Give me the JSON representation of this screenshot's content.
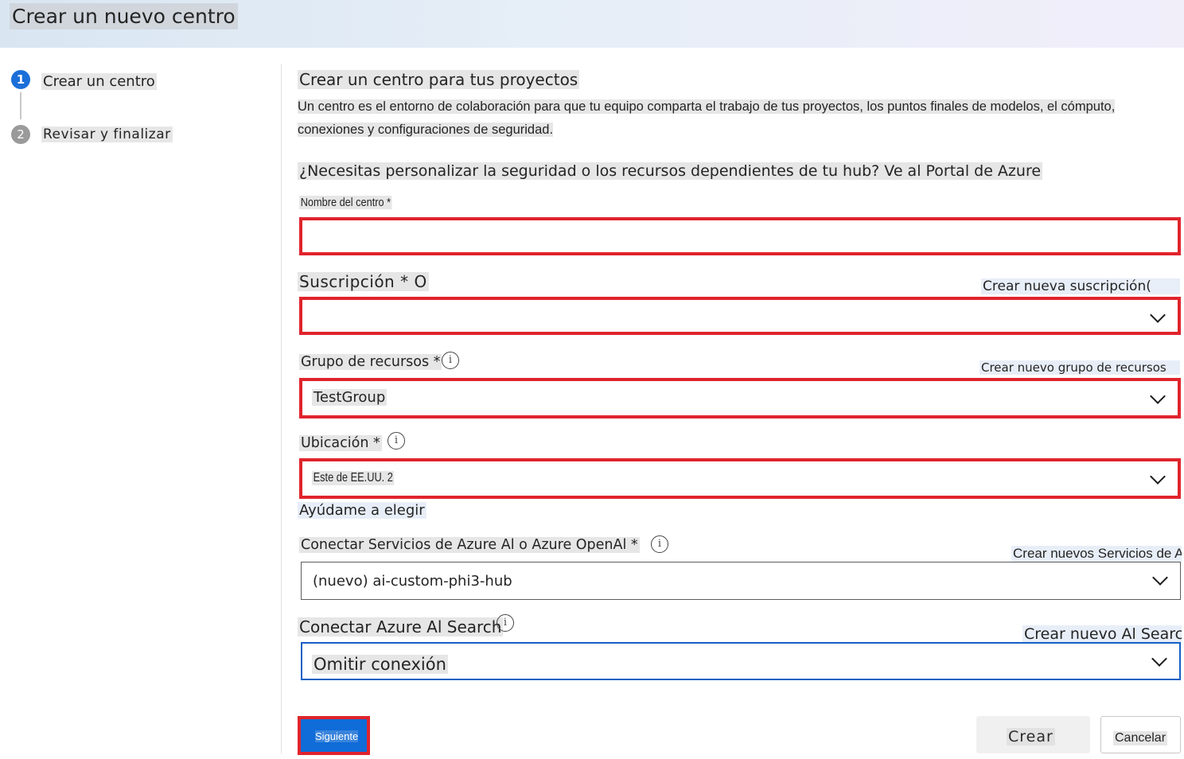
{
  "header": {
    "title": "Crear un nuevo centro"
  },
  "steps": [
    {
      "number": "1",
      "label": "Crear un centro"
    },
    {
      "number": "2",
      "label": "Revisar y finalizar"
    }
  ],
  "main": {
    "section_title": "Crear un centro para tus proyectos",
    "description_line1": "Un centro es el entorno de colaboración para que tu equipo comparta el trabajo de tus proyectos, los puntos finales de modelos, el cómputo,",
    "description_line2": "conexiones y configuraciones de seguridad.",
    "portal_question": "¿Necesitas personalizar la seguridad o los recursos dependientes de tu hub? Ve al Portal de Azure"
  },
  "fields": {
    "hub_name": {
      "label": "Nombre del centro *",
      "value": ""
    },
    "subscription": {
      "label": "Suscripción * O",
      "link": "Crear nueva suscripción(",
      "value": ""
    },
    "resource_group": {
      "label": "Grupo de recursos *",
      "link": "Crear nuevo grupo de recursos",
      "value": "TestGroup"
    },
    "location": {
      "label": "Ubicación *",
      "value": "Este de EE.UU. 2",
      "help_link": "Ayúdame a elegir"
    },
    "ai_services": {
      "label": "Conectar Servicios de Azure Al o Azure OpenAl *",
      "link": "Crear nuevos Servicios de Al",
      "value": "(nuevo) ai-custom-phi3-hub"
    },
    "ai_search": {
      "label": "Conectar Azure Al Search",
      "link": "Crear nuevo Al Search",
      "value": "Omitir conexión"
    }
  },
  "footer": {
    "next_label": "Siguiente",
    "create_label": "Crear",
    "cancel_label": "Cancelar"
  },
  "icons": {
    "info": "info-icon",
    "chevron": "chevron-down-icon"
  },
  "colors": {
    "accent": "#0f6cd8",
    "highlight_border": "#e0242c",
    "focus_border": "#1460c4"
  }
}
